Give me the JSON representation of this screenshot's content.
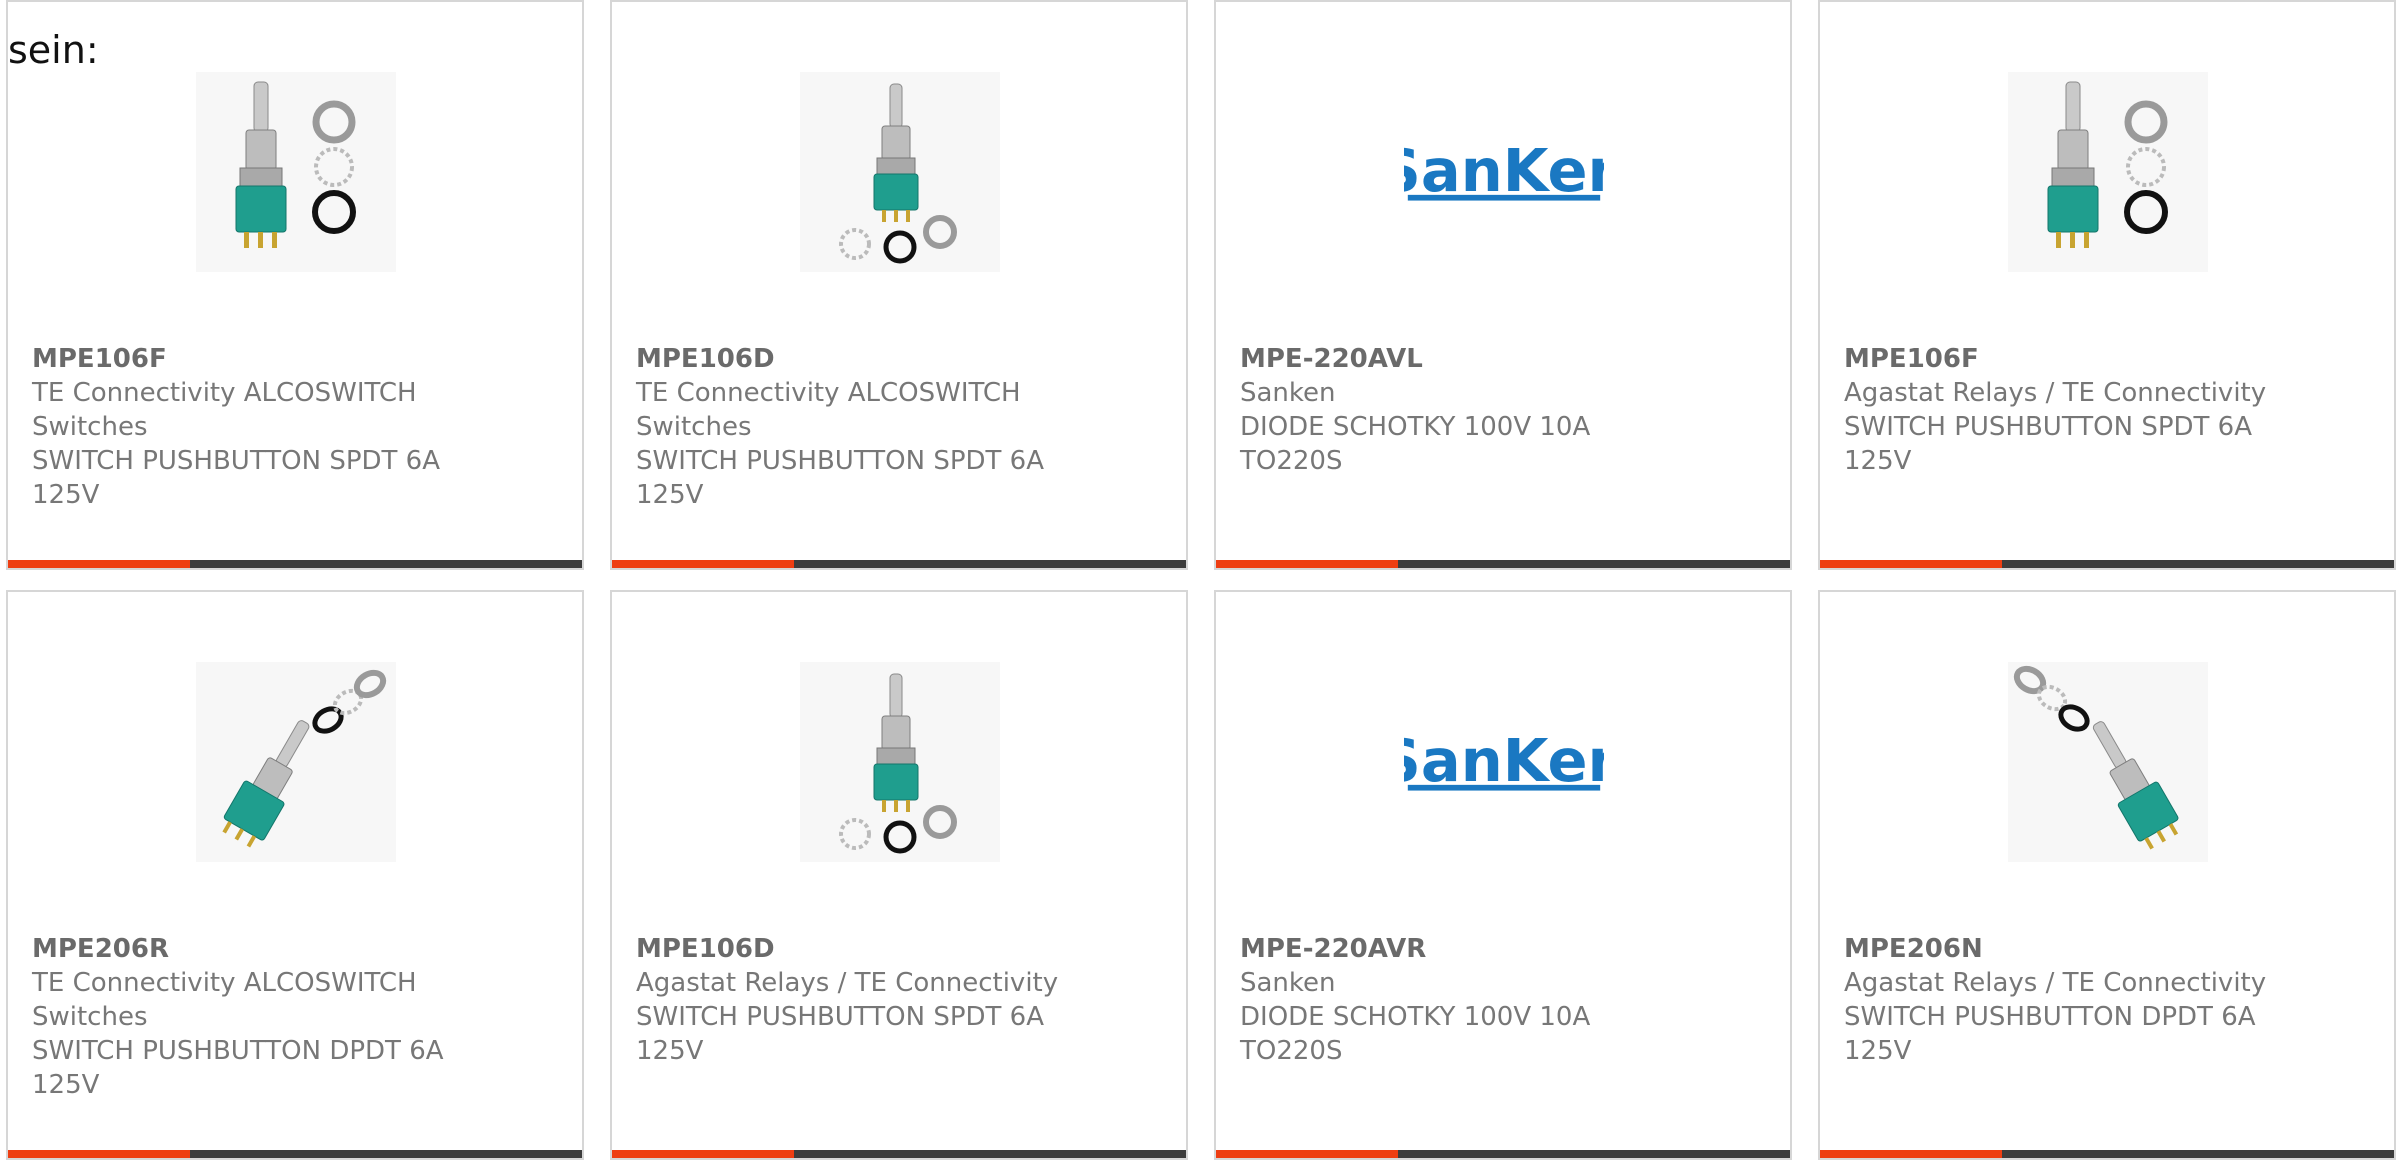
{
  "intro": {
    "text": "sein:"
  },
  "colors": {
    "accent": "#ee3e12",
    "bar": "#3c3c3c",
    "text": "#777777",
    "border": "#d6d6d6",
    "sanken_blue": "#1a78c2"
  },
  "products": [
    {
      "part_number": "MPE106F",
      "manufacturer": "TE Connectivity ALCOSWITCH Switches",
      "description": "SWITCH PUSHBUTTON SPDT 6A 125V",
      "image": "pushbutton-switch-upright-rings-right"
    },
    {
      "part_number": "MPE106D",
      "manufacturer": "TE Connectivity ALCOSWITCH Switches",
      "description": "SWITCH PUSHBUTTON SPDT 6A 125V",
      "image": "pushbutton-switch-upright-rings-below"
    },
    {
      "part_number": "MPE-220AVL",
      "manufacturer": "Sanken",
      "description": "DIODE SCHOTKY 100V 10A TO220S",
      "image": "sanken-logo",
      "logo_text": "SanKen"
    },
    {
      "part_number": "MPE106F",
      "manufacturer": "Agastat Relays / TE Connectivity",
      "description": "SWITCH PUSHBUTTON SPDT 6A 125V",
      "image": "pushbutton-switch-upright-rings-right"
    },
    {
      "part_number": "MPE206R",
      "manufacturer": "TE Connectivity ALCOSWITCH Switches",
      "description": "SWITCH PUSHBUTTON DPDT 6A 125V",
      "image": "pushbutton-switch-tilted-left"
    },
    {
      "part_number": "MPE106D",
      "manufacturer": "Agastat Relays / TE Connectivity",
      "description": "SWITCH PUSHBUTTON SPDT 6A 125V",
      "image": "pushbutton-switch-upright-rings-below"
    },
    {
      "part_number": "MPE-220AVR",
      "manufacturer": "Sanken",
      "description": "DIODE SCHOTKY 100V 10A TO220S",
      "image": "sanken-logo",
      "logo_text": "SanKen"
    },
    {
      "part_number": "MPE206N",
      "manufacturer": "Agastat Relays / TE Connectivity",
      "description": "SWITCH PUSHBUTTON DPDT 6A 125V",
      "image": "pushbutton-switch-tilted-right"
    }
  ]
}
